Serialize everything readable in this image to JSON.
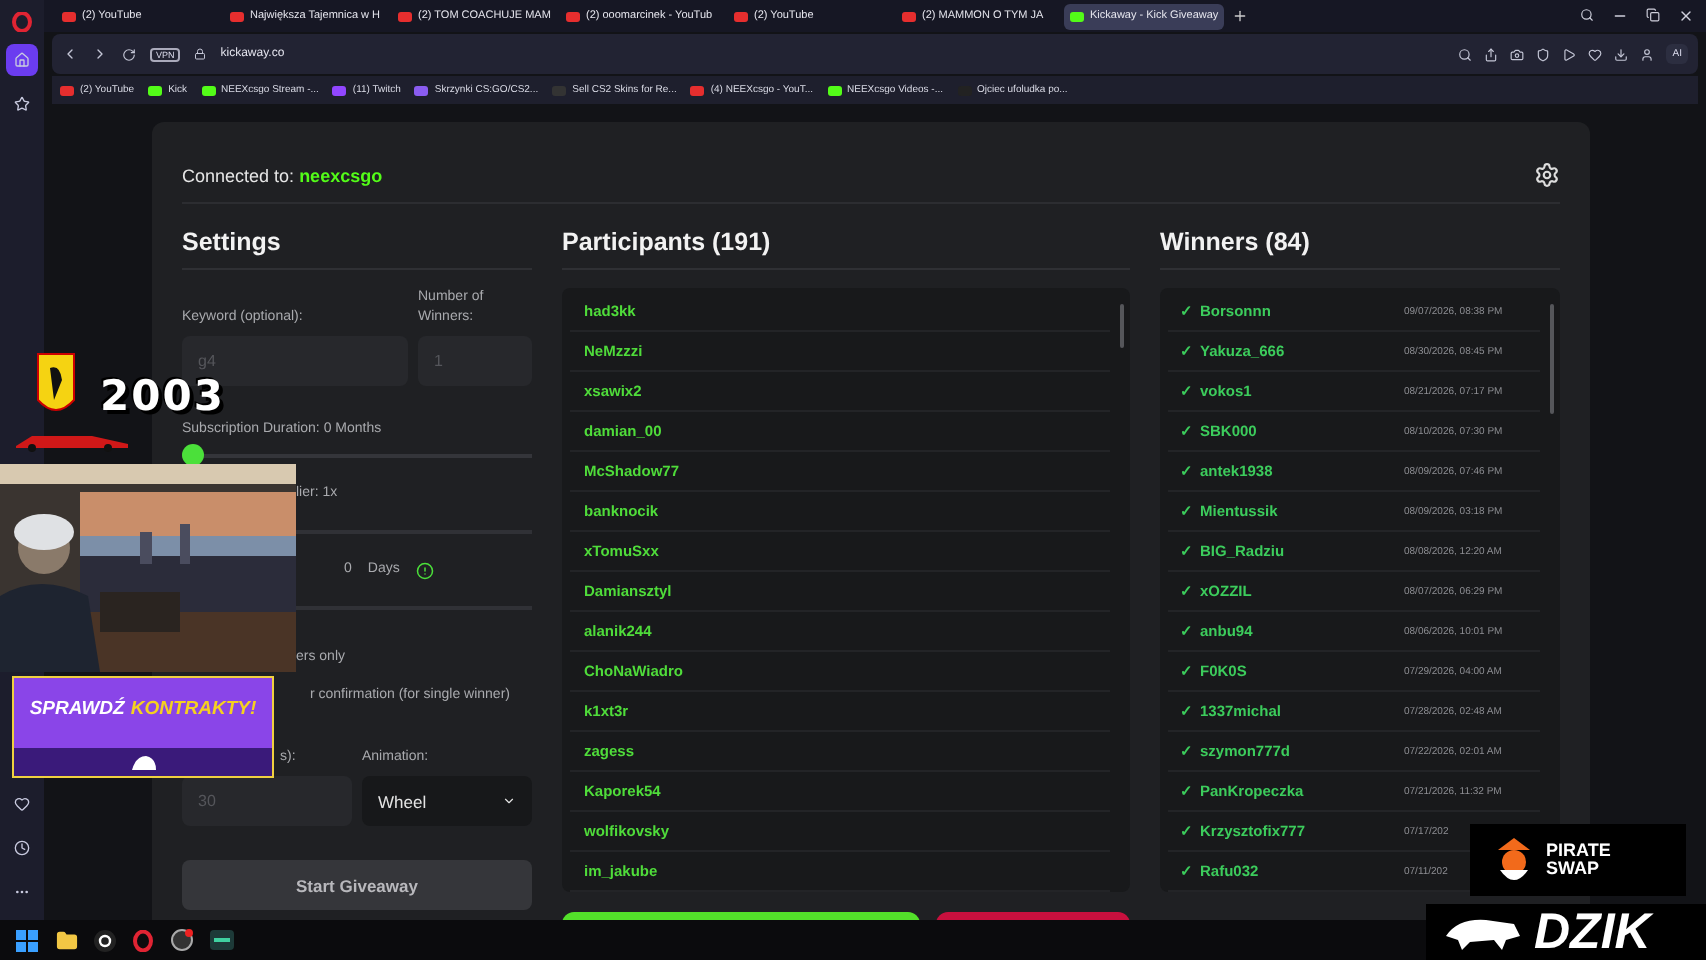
{
  "browser": {
    "tabs": [
      {
        "kind": "youtube",
        "title": "(2) YouTube",
        "selected": false
      },
      {
        "kind": "youtube",
        "title": "Największa Tajemnica w H",
        "selected": false
      },
      {
        "kind": "youtube",
        "title": "(2) TOM COACHUJE MAM",
        "selected": false
      },
      {
        "kind": "youtube",
        "title": "(2) ooomarcinek - YouTub",
        "selected": false
      },
      {
        "kind": "youtube",
        "title": "(2) YouTube",
        "selected": false
      },
      {
        "kind": "youtube",
        "title": "(2) MAMMON O TYM JA",
        "selected": false
      },
      {
        "kind": "kick",
        "title": "Kickaway - Kick Giveaway",
        "selected": true
      }
    ],
    "vpn_badge": "VPN",
    "address": "kickaway.co",
    "ai_button": "AI",
    "bookmarks": [
      {
        "kind": "youtube",
        "title": "(2) YouTube"
      },
      {
        "kind": "kick",
        "title": "Kick"
      },
      {
        "kind": "kick",
        "title": "NEEXcsgo Stream -..."
      },
      {
        "kind": "twitch",
        "title": "(11) Twitch"
      },
      {
        "kind": "gem",
        "title": "Skrzynki CS:GO/CS2..."
      },
      {
        "kind": "plain",
        "title": "Sell CS2 Skins for Re..."
      },
      {
        "kind": "youtube",
        "title": "(4) NEEXcsgo - YouT..."
      },
      {
        "kind": "kick",
        "title": "NEEXcsgo Videos -..."
      },
      {
        "kind": "tiktok",
        "title": "Ojciec ufoludka po..."
      }
    ]
  },
  "connection": {
    "label": "Connected to:",
    "channel": "neexcsgo"
  },
  "settings": {
    "title": "Settings",
    "keyword": {
      "label": "Keyword (optional):",
      "placeholder": "g4"
    },
    "winner_count": {
      "label": "Number of Winners:",
      "placeholder": "1"
    },
    "subscription": {
      "label": "Subscription Duration: 0 Months",
      "level": 0
    },
    "multiplier": {
      "label": "lier: 1x"
    },
    "days": {
      "value": "0",
      "unit": "Days"
    },
    "subscribers_only": {
      "label": "ers only"
    },
    "confirmation": {
      "label": "r confirmation (for single winner)"
    },
    "timer": {
      "label": "s):",
      "placeholder": "30"
    },
    "animation": {
      "label": "Animation:",
      "value": "Wheel"
    },
    "start_button": "Start Giveaway"
  },
  "participants": {
    "title": "Participants (191)",
    "names": [
      "had3kk",
      "NeMzzzi",
      "xsawix2",
      "damian_00",
      "McShadow77",
      "banknocik",
      "xTomuSxx",
      "Damiansztyl",
      "alanik244",
      "ChoNaWiadro",
      "k1xt3r",
      "zagess",
      "Kaporek54",
      "wolfikovsky",
      "im_jakube"
    ]
  },
  "winners": {
    "title": "Winners (84)",
    "rows": [
      {
        "check": "✓",
        "name": "Borsonnn",
        "date": "09/07/2026, 08:38 PM"
      },
      {
        "check": "✓",
        "name": "Yakuza_666",
        "date": "08/30/2026, 08:45 PM"
      },
      {
        "check": "✓",
        "name": "vokos1",
        "date": "08/21/2026, 07:17 PM"
      },
      {
        "check": "✓",
        "name": "SBK000",
        "date": "08/10/2026, 07:30 PM"
      },
      {
        "check": "✓",
        "name": "antek1938",
        "date": "08/09/2026, 07:46 PM"
      },
      {
        "check": "✓",
        "name": "Mientussik",
        "date": "08/09/2026, 03:18 PM"
      },
      {
        "check": "✓",
        "name": "BIG_Radziu",
        "date": "08/08/2026, 12:20 AM"
      },
      {
        "check": "✓",
        "name": "xOZZIL",
        "date": "08/07/2026, 06:29 PM"
      },
      {
        "check": "✓",
        "name": "anbu94",
        "date": "08/06/2026, 10:01 PM"
      },
      {
        "check": "✓",
        "name": "F0K0S",
        "date": "07/29/2026, 04:00 AM"
      },
      {
        "check": "✓",
        "name": "1337michal",
        "date": "07/28/2026, 02:48 AM"
      },
      {
        "check": "✓",
        "name": "szymon777d",
        "date": "07/22/2026, 02:01 AM"
      },
      {
        "check": "✓",
        "name": "PanKropeczka",
        "date": "07/21/2026, 11:32 PM"
      },
      {
        "check": "✓",
        "name": "Krzysztofix777",
        "date": "07/17/202"
      },
      {
        "check": "✓",
        "name": "Rafu032",
        "date": "07/11/202"
      }
    ]
  },
  "overlays": {
    "year": "2003",
    "ad": {
      "first": "SPRAWDŹ",
      "second": "KONTRAKTY!"
    },
    "sponsor": {
      "first": "PIRATE",
      "second": "SWAP"
    },
    "brand": "DZIK"
  }
}
